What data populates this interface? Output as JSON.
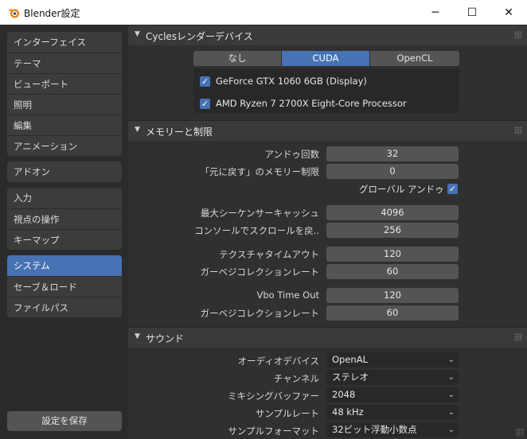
{
  "window": {
    "title": "Blender設定",
    "minimize": "─",
    "maximize": "☐",
    "close": "✕"
  },
  "sidebar": {
    "groups": [
      [
        "インターフェイス",
        "テーマ",
        "ビューポート",
        "照明",
        "編集",
        "アニメーション"
      ],
      [
        "アドオン"
      ],
      [
        "入力",
        "視点の操作",
        "キーマップ"
      ],
      [
        "システム",
        "セーブ＆ロード",
        "ファイルパス"
      ]
    ],
    "active": "システム",
    "save_button": "設定を保存"
  },
  "cycles": {
    "header": "Cyclesレンダーデバイス",
    "tabs": [
      "なし",
      "CUDA",
      "OpenCL"
    ],
    "active_tab": "CUDA",
    "devices": [
      {
        "name": "GeForce GTX 1060 6GB (Display)",
        "checked": true
      },
      {
        "name": "AMD Ryzen 7 2700X Eight-Core Processor",
        "checked": true
      }
    ]
  },
  "memory": {
    "header": "メモリーと制限",
    "undo_steps_label": "アンドゥ回数",
    "undo_steps": "32",
    "undo_memory_label": "「元に戻す」のメモリー制限",
    "undo_memory": "0",
    "global_undo_label": "グローバル アンドゥ",
    "global_undo": true,
    "sequencer_cache_label": "最大シーケンサーキャッシュ",
    "sequencer_cache": "4096",
    "console_scroll_label": "コンソールでスクロールを戻..",
    "console_scroll": "256",
    "texture_timeout_label": "テクスチャタイムアウト",
    "texture_timeout": "120",
    "texture_gc_label": "ガーベジコレクションレート",
    "texture_gc": "60",
    "vbo_timeout_label": "Vbo Time Out",
    "vbo_timeout": "120",
    "vbo_gc_label": "ガーベジコレクションレート",
    "vbo_gc": "60"
  },
  "sound": {
    "header": "サウンド",
    "device_label": "オーディオデバイス",
    "device": "OpenAL",
    "channels_label": "チャンネル",
    "channels": "ステレオ",
    "buffer_label": "ミキシングバッファー",
    "buffer": "2048",
    "rate_label": "サンプルレート",
    "rate": "48 kHz",
    "format_label": "サンプルフォーマット",
    "format": "32ビット浮動小数点"
  },
  "colors": {
    "accent": "#4772b3",
    "background": "#303030",
    "field": "#545454"
  }
}
